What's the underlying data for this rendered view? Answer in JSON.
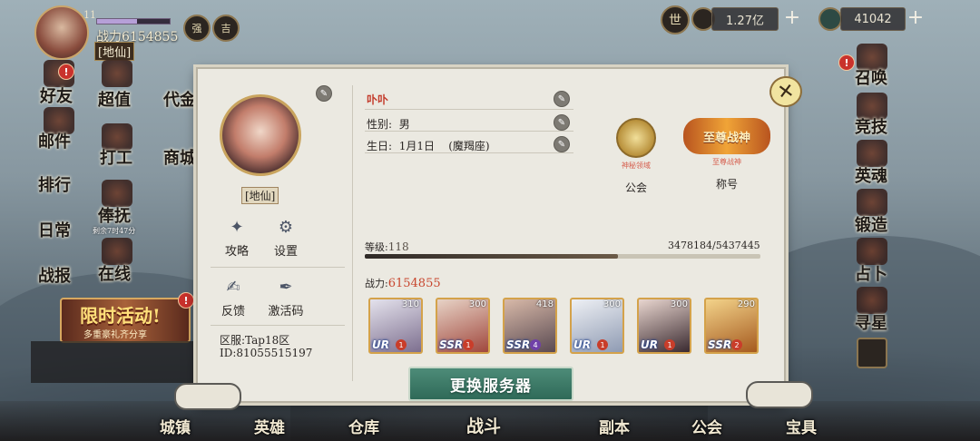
{
  "player": {
    "vip": "11",
    "vip_progress": 0.55,
    "power_label": "战力",
    "power_value": "6154855",
    "rank": "[地仙]"
  },
  "top_buttons": [
    "强",
    "吉"
  ],
  "resources": {
    "gold_amount": "1.27亿",
    "jade_amount": "41042",
    "plus": "+",
    "world_label": "世"
  },
  "left_menu": [
    {
      "label": "好友",
      "badge": "!"
    },
    {
      "label": "超值",
      "badge": ""
    },
    {
      "label": "代金",
      "badge": ""
    },
    {
      "label": "邮件",
      "badge": ""
    },
    {
      "label": "打工",
      "badge": ""
    },
    {
      "label": "商城",
      "badge": ""
    },
    {
      "label": "排行",
      "badge": ""
    },
    {
      "label": "日常",
      "badge": ""
    },
    {
      "label": "俸抚",
      "badge": "",
      "sub": "剩余7时47分"
    },
    {
      "label": "战报",
      "badge": ""
    },
    {
      "label": "在线",
      "badge": ""
    }
  ],
  "event": {
    "title": "限时活动!",
    "subtitle": "多重豪礼齐分享",
    "badge": "!"
  },
  "right_menu": [
    {
      "label": "召唤",
      "badge": "!"
    },
    {
      "label": "竞技",
      "badge": ""
    },
    {
      "label": "英魂",
      "badge": ""
    },
    {
      "label": "锻造",
      "badge": ""
    },
    {
      "label": "占卜",
      "badge": ""
    },
    {
      "label": "寻星",
      "badge": ""
    }
  ],
  "bottom_nav": [
    "城镇",
    "英雄",
    "仓库",
    "战斗",
    "副本",
    "公会",
    "宝具"
  ],
  "profile": {
    "rank": "[地仙]",
    "name": "卟卟",
    "gender_label": "性别:",
    "gender": "男",
    "birthday_label": "生日:",
    "birthday": "1月1日",
    "zodiac": "(魔羯座)",
    "guild_label": "公会",
    "guild_emblem_text": "神秘领域",
    "title_label": "称号",
    "title_badge": "至尊战神",
    "title_sub": "至尊战神",
    "level_label": "等级:",
    "level": "118",
    "exp": "3478184/5437445",
    "exp_progress": 0.64,
    "power_label": "战力:",
    "power": "6154855",
    "server_label": "区服:",
    "server": "Tap18区",
    "id_label": "ID:",
    "id": "81055515197",
    "swap_button": "更换服务器",
    "close": "✕"
  },
  "function_buttons": [
    {
      "label": "攻略",
      "icon": "sparkle-icon"
    },
    {
      "label": "设置",
      "icon": "gear-icon"
    },
    {
      "label": "反馈",
      "icon": "pencil-icon"
    },
    {
      "label": "激活码",
      "icon": "quill-icon"
    }
  ],
  "heroes": [
    {
      "level": "310",
      "rarity": "UR",
      "star": "1"
    },
    {
      "level": "300",
      "rarity": "SSR",
      "star": "1"
    },
    {
      "level": "418",
      "rarity": "SSR",
      "star": "4"
    },
    {
      "level": "300",
      "rarity": "UR",
      "star": "1"
    },
    {
      "level": "300",
      "rarity": "UR",
      "star": "1"
    },
    {
      "level": "290",
      "rarity": "SSR",
      "star": "2"
    }
  ],
  "colors": {
    "name_red": "#c33a2a",
    "power_red": "#c8462e",
    "swap_green": "#3c7b66"
  }
}
